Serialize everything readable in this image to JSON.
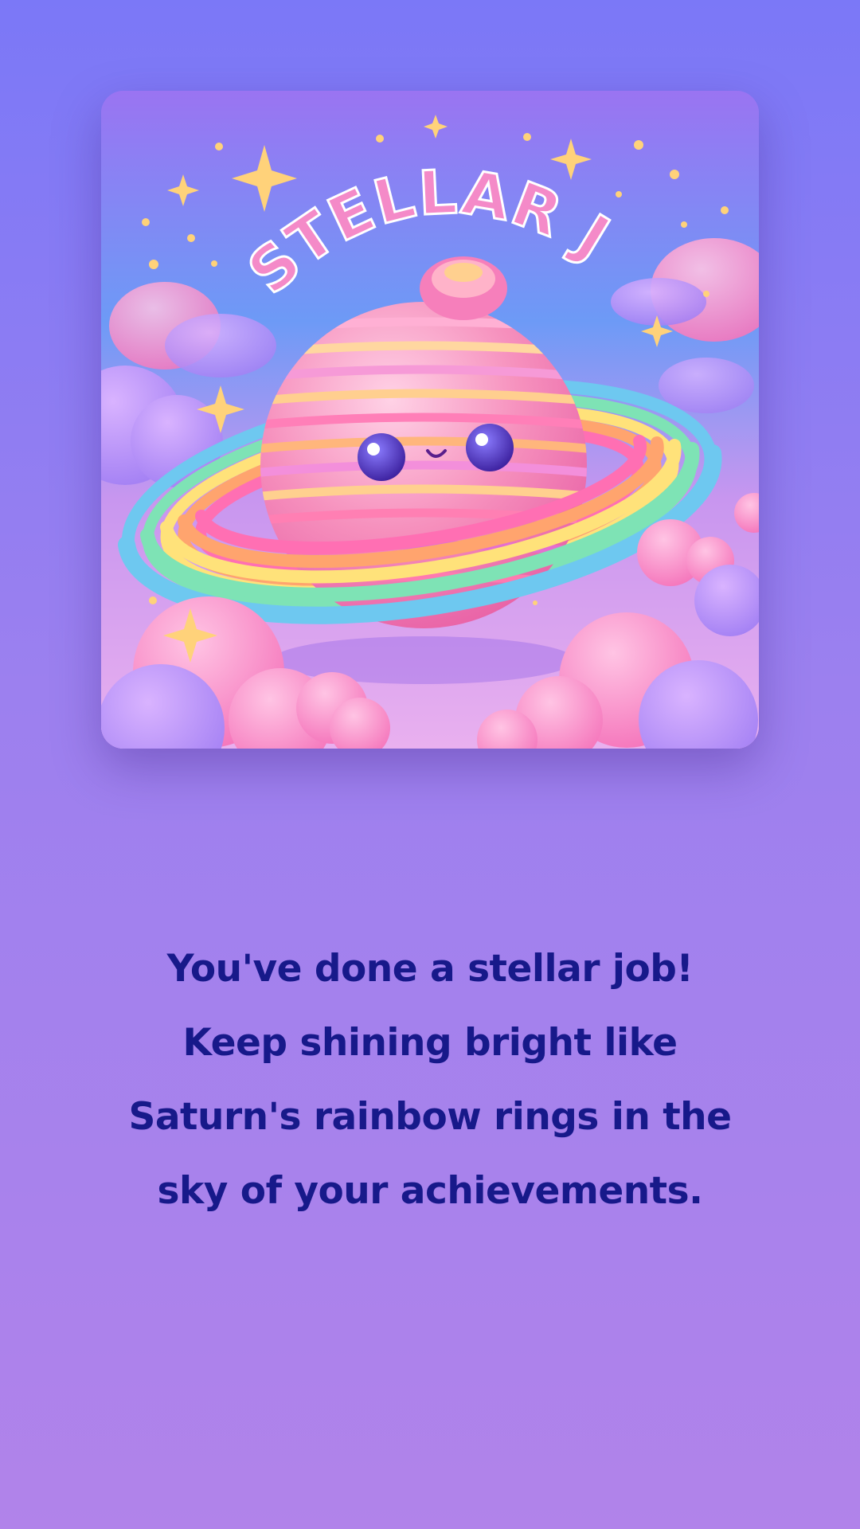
{
  "illustration": {
    "arched_title": "STELLAR JOB",
    "subject_icon": "cute-saturn-planet-icon",
    "colors": {
      "sky_top": "#8f73f3",
      "sky_mid": "#6f96f6",
      "cloud_pink": "#f58fcf",
      "star_gold": "#ffd27a",
      "title_pink": "#f48ac8"
    }
  },
  "message": {
    "text": "You've done a stellar job! Keep shining bright like Saturn's rainbow rings in the sky of your achievements."
  },
  "colors": {
    "background_top": "#7b78f7",
    "background_bottom": "#b183ea",
    "message_text": "#17198a"
  }
}
